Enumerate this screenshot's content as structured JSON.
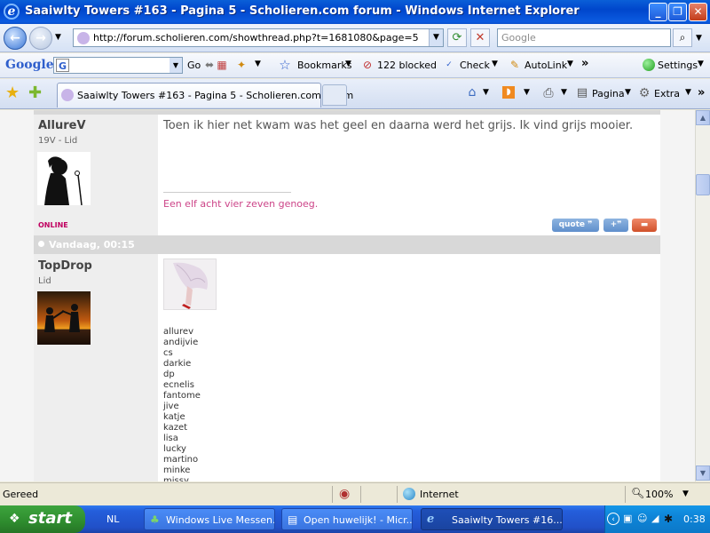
{
  "window": {
    "title": "Saaiwlty Towers #163 - Pagina 5 - Scholieren.com forum - Windows Internet Explorer",
    "minimize": "_",
    "maximize": "❐",
    "close": "✕"
  },
  "address": {
    "url": "http://forum.scholieren.com/showthread.php?t=1681080&page=5",
    "search_placeholder": "Google"
  },
  "google_toolbar": {
    "logo": "Google",
    "go": "Go",
    "bookmarks": "Bookmarks",
    "blocked": "122 blocked",
    "check": "Check",
    "autolink": "AutoLink",
    "more": "»",
    "settings": "Settings"
  },
  "tabs": {
    "active_label": "Saaiwlty Towers #163 - Pagina 5 - Scholieren.com forum",
    "pagina": "Pagina",
    "extra": "Extra"
  },
  "posts": [
    {
      "username": "AllureV",
      "usertitle": "19V - Lid",
      "status": "ONLINE",
      "message": "Toen ik hier net kwam was het geel en daarna werd het grijs. Ik vind grijs mooier.",
      "signature": "Een elf acht vier zeven genoeg."
    },
    {
      "date": "Vandaag, 00:15",
      "username": "TopDrop",
      "usertitle": "Lid",
      "members": [
        "allurev",
        "andijvie",
        "cs",
        "darkie",
        "dp",
        "ecnelis",
        "fantome",
        "jive",
        "katje",
        "kazet",
        "lisa",
        "lucky",
        "martino",
        "minke",
        "missy"
      ]
    }
  ],
  "buttons": {
    "quote": "quote"
  },
  "statusbar": {
    "status": "Gereed",
    "zone": "Internet",
    "zoom": "100%"
  },
  "taskbar": {
    "start": "start",
    "lang": "NL",
    "items": [
      "Windows Live Messen...",
      "Open huwelijk! - Micr...",
      "Saaiwlty Towers #16..."
    ],
    "clock": "0:38"
  },
  "colors": {
    "titlebar": "#0A5FD8",
    "signature": "#CC4488",
    "online": "#C00060"
  }
}
